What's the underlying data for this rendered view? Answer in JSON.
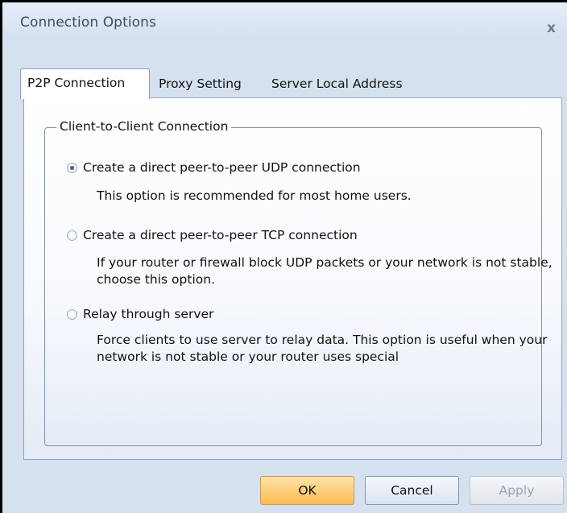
{
  "window": {
    "title": "Connection Options",
    "close_glyph": "x"
  },
  "tabs": [
    {
      "label": "P2P Connection",
      "active": true
    },
    {
      "label": "Proxy Setting",
      "active": false
    },
    {
      "label": "Server Local Address",
      "active": false
    }
  ],
  "group": {
    "title": "Client-to-Client Connection",
    "options": [
      {
        "label": "Create a direct peer-to-peer UDP connection",
        "checked": true,
        "description": "This option is recommended for most home users."
      },
      {
        "label": "Create a direct peer-to-peer TCP connection",
        "checked": false,
        "description": "If your router or firewall block UDP packets or your network is not stable, choose this option."
      },
      {
        "label": "Relay through server",
        "checked": false,
        "description": "Force clients to use server to relay data. This option is useful when your network is not stable or your router uses special"
      }
    ]
  },
  "buttons": {
    "ok": "OK",
    "cancel": "Cancel",
    "apply": "Apply",
    "apply_enabled": false
  },
  "colors": {
    "window_bg": "#d6e1f0",
    "ok_button": "#fdbb52",
    "border": "#8da2c0"
  }
}
